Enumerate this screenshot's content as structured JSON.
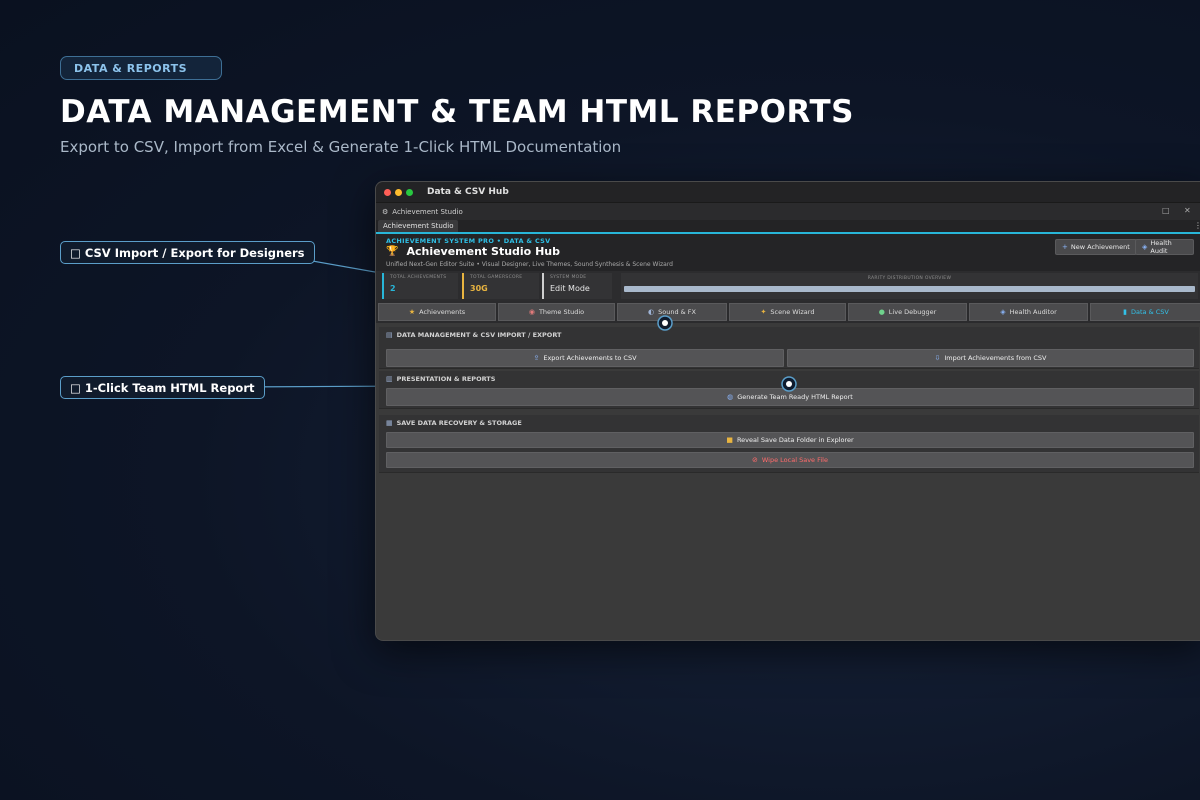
{
  "hero": {
    "badge": "DATA & REPORTS",
    "title": "DATA MANAGEMENT & TEAM HTML REPORTS",
    "subtitle": "Export to CSV, Import from Excel & Generate 1-Click HTML Documentation"
  },
  "callouts": {
    "csv": "□ CSV Import / Export for Designers",
    "report": "□ 1-Click Team HTML Report"
  },
  "window": {
    "title": "Data & CSV Hub",
    "menu_title": "Achievement Studio",
    "tab": "Achievement Studio"
  },
  "header": {
    "breadcrumb": "ACHIEVEMENT SYSTEM PRO  •  DATA & CSV",
    "title": "Achievement Studio Hub",
    "subtitle": "Unified Next-Gen Editor Suite • Visual Designer, Live Themes, Sound Synthesis & Scene Wizard",
    "new_button": "New Achievement",
    "health_button": "Health Audit"
  },
  "stats": {
    "total_label": "TOTAL ACHIEVEMENTS",
    "total_value": "2",
    "score_label": "TOTAL GAMERSCORE",
    "score_value": "30G",
    "mode_label": "SYSTEM MODE",
    "mode_value": "Edit Mode",
    "rarity_label": "RARITY DISTRIBUTION OVERVIEW"
  },
  "nav": {
    "achievements": "Achievements",
    "theme": "Theme Studio",
    "sound": "Sound & FX",
    "scene": "Scene Wizard",
    "debugger": "Live Debugger",
    "auditor": "Health Auditor",
    "data": "Data & CSV"
  },
  "sections": {
    "data_title": "DATA MANAGEMENT & CSV IMPORT / EXPORT",
    "export_btn": "Export Achievements to CSV",
    "import_btn": "Import Achievements from CSV",
    "reports_title": "PRESENTATION & REPORTS",
    "report_btn": "Generate Team Ready HTML Report",
    "storage_title": "SAVE DATA RECOVERY & STORAGE",
    "reveal_btn": "Reveal Save Data Folder in Explorer",
    "wipe_btn": "Wipe Local Save File"
  },
  "colors": {
    "accent": "#28b6d8",
    "gold": "#e8b440",
    "danger": "#ff6b6b"
  }
}
